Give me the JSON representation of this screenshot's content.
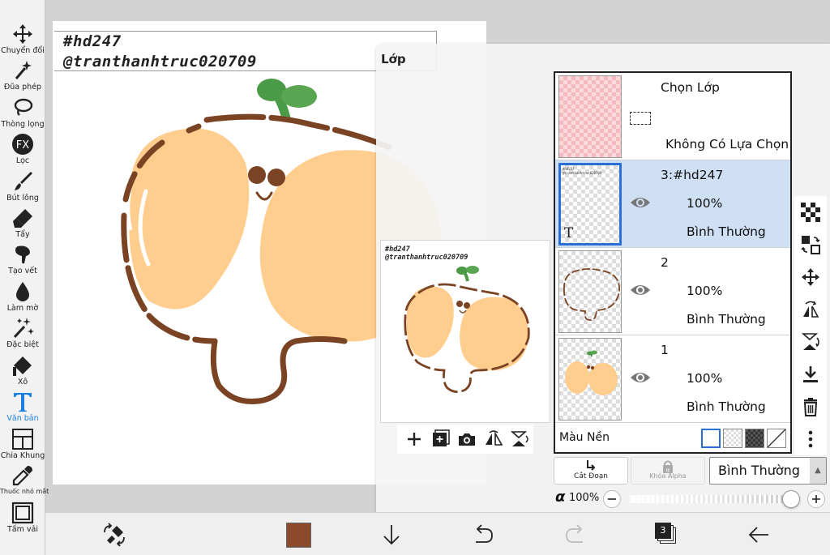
{
  "tools": [
    {
      "name": "move-tool",
      "icon": "move-arrows-icon",
      "label": "Chuyển đổi"
    },
    {
      "name": "magic-wand-tool",
      "icon": "magic-wand-icon",
      "label": "Đũa phép"
    },
    {
      "name": "lasso-tool",
      "icon": "lasso-icon",
      "label": "Thòng lọng"
    },
    {
      "name": "filter-tool",
      "icon": "fx-icon",
      "label": "Lọc"
    },
    {
      "name": "brush-tool",
      "icon": "brush-icon",
      "label": "Bút lông"
    },
    {
      "name": "eraser-tool",
      "icon": "eraser-icon",
      "label": "Tẩy"
    },
    {
      "name": "smudge-tool",
      "icon": "smudge-icon",
      "label": "Tạo vết"
    },
    {
      "name": "blur-tool",
      "icon": "blur-drop-icon",
      "label": "Làm mờ"
    },
    {
      "name": "special-tool",
      "icon": "sparkle-wand-icon",
      "label": "Đặc biệt"
    },
    {
      "name": "bucket-tool",
      "icon": "paint-bucket-icon",
      "label": "Xô"
    },
    {
      "name": "text-tool",
      "icon": "text-t-icon",
      "label": "Văn bản"
    },
    {
      "name": "frame-divider-tool",
      "icon": "frame-divider-icon",
      "label": "Chia Khung"
    },
    {
      "name": "eyedropper-tool",
      "icon": "eyedropper-icon",
      "label": "Thuốc nhỏ mắt"
    },
    {
      "name": "canvas-tool",
      "icon": "canvas-square-icon",
      "label": "Tấm vải"
    }
  ],
  "canvas": {
    "line1": "#hd247",
    "line2": "@tranthanhtruc020709"
  },
  "panel": {
    "title": "Lớp",
    "selection_layer": {
      "title": "Chọn Lớp",
      "status": "Không Có Lựa Chọn"
    },
    "layers": [
      {
        "name": "3:#hd247",
        "opacity": "100%",
        "mode": "Bình Thường",
        "selected": true,
        "thumb_type": "text"
      },
      {
        "name": "2",
        "opacity": "100%",
        "mode": "Bình Thường",
        "selected": false,
        "thumb_type": "outline"
      },
      {
        "name": "1",
        "opacity": "100%",
        "mode": "Bình Thường",
        "selected": false,
        "thumb_type": "color"
      }
    ],
    "background_label": "Màu Nền",
    "clip_label": "Cắt Đoạn",
    "alpha_lock_label": "Khóa Alpha",
    "blend_mode": "Bình Thường",
    "alpha_symbol": "α",
    "alpha_value": "100%",
    "alpha_level": 1.0,
    "preview_tag1": "#hd247",
    "preview_tag2": "@tranthanhtruc020709",
    "thumb_text_glyph": "T"
  },
  "bottom": {
    "layer_count": "3",
    "current_color": "#8b4a2b"
  },
  "colors": {
    "accent": "#1a7de0",
    "selected_layer": "#cfdff4",
    "peach": "#ffcd8e",
    "brown_outline": "#7a4424",
    "leaf": "#4b9a47"
  }
}
